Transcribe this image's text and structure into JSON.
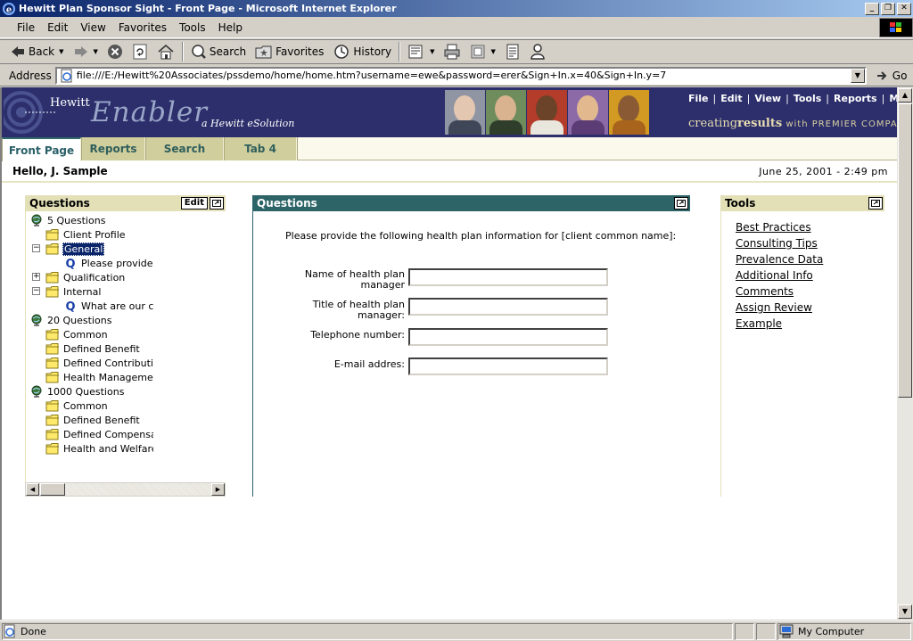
{
  "window": {
    "title": "Hewitt Plan Sponsor Sight - Front Page - Microsoft Internet Explorer"
  },
  "menubar": [
    "File",
    "Edit",
    "View",
    "Favorites",
    "Tools",
    "Help"
  ],
  "toolbar": {
    "back": "Back",
    "search": "Search",
    "favorites": "Favorites",
    "history": "History"
  },
  "address": {
    "label": "Address",
    "url": "file:///E:/Hewitt%20Associates/pssdemo/home/home.htm?username=ewe&password=erer&Sign+In.x=40&Sign+In.y=7",
    "go": "Go"
  },
  "banner": {
    "hewitt": "Hewitt",
    "enabler": "Enabler",
    "esolution": "a Hewitt eSolution",
    "menu": [
      "File",
      "Edit",
      "View",
      "Tools",
      "Reports",
      "Misc"
    ],
    "tagline_creating": "creating",
    "tagline_results": "results",
    "tagline_with": "with PREMIER COMPANY"
  },
  "tabs": [
    "Front Page",
    "Reports",
    "Search",
    "Tab 4"
  ],
  "greeting": "Hello, J. Sample",
  "datetime": "June 25, 2001 - 2:49 pm",
  "left_panel": {
    "title": "Questions",
    "edit_label": "Edit",
    "tree": [
      {
        "label": "5 Questions",
        "type": "globe"
      },
      {
        "label": "Client Profile",
        "type": "folder"
      },
      {
        "label": "General",
        "type": "folder",
        "selected": true
      },
      {
        "label": "Please provide the",
        "type": "question"
      },
      {
        "label": "Qualification",
        "type": "folder"
      },
      {
        "label": "Internal",
        "type": "folder"
      },
      {
        "label": "What are our cha",
        "type": "question"
      },
      {
        "label": "20 Questions",
        "type": "globe"
      },
      {
        "label": "Common",
        "type": "folder"
      },
      {
        "label": "Defined Benefit",
        "type": "folder"
      },
      {
        "label": "Defined Contribution",
        "type": "folder"
      },
      {
        "label": "Health Management",
        "type": "folder"
      },
      {
        "label": "1000 Questions",
        "type": "globe"
      },
      {
        "label": "Common",
        "type": "folder"
      },
      {
        "label": "Defined Benefit",
        "type": "folder"
      },
      {
        "label": "Defined Compensation",
        "type": "folder"
      },
      {
        "label": "Health and Welfare",
        "type": "folder"
      }
    ]
  },
  "main_panel": {
    "title": "Questions",
    "instructions": "Please provide the following health plan information for [client common name]:",
    "fields": [
      {
        "label": "Name of health plan manager",
        "value": ""
      },
      {
        "label": "Title of health plan manager:",
        "value": ""
      },
      {
        "label": "Telephone number:",
        "value": ""
      },
      {
        "label": "E-mail addres:",
        "value": ""
      }
    ]
  },
  "tools_panel": {
    "title": "Tools",
    "links": [
      "Best Practices",
      "Consulting Tips",
      "Prevalence Data",
      "Additional Info",
      "Comments",
      "Assign Review",
      "Example"
    ]
  },
  "status": {
    "text": "Done",
    "zone": "My Computer"
  },
  "colors": {
    "banner": "#2c2f6b",
    "tab_bar": "#dad7b1",
    "panel_accent": "#2d6467",
    "selection": "#0a246a"
  }
}
